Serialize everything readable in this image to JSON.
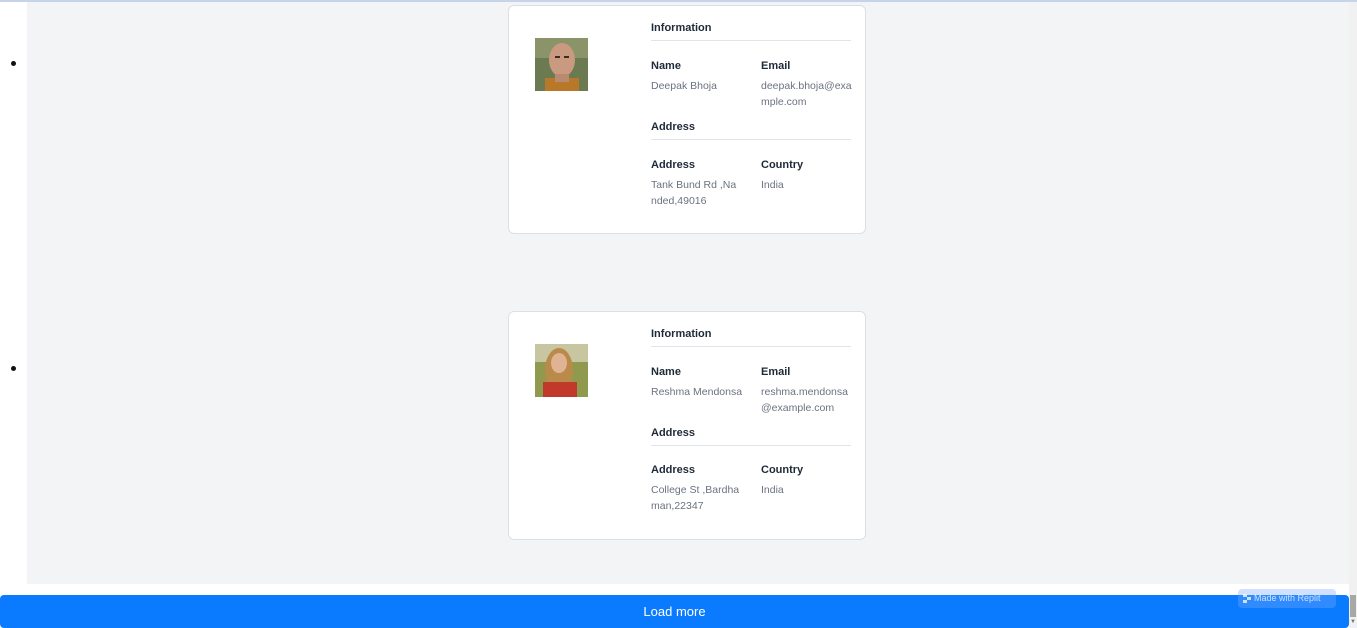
{
  "users": [
    {
      "section_information": "Information",
      "name_label": "Name",
      "name": "Deepak Bhoja",
      "email_label": "Email",
      "email": "deepak.bhoja@example.com",
      "section_address": "Address",
      "address_label": "Address",
      "address": "Tank Bund Rd ,Nanded,49016",
      "country_label": "Country",
      "country": "India"
    },
    {
      "section_information": "Information",
      "name_label": "Name",
      "name": "Reshma Mendonsa",
      "email_label": "Email",
      "email": "reshma.mendonsa@example.com",
      "section_address": "Address",
      "address_label": "Address",
      "address": "College St ,Bardhaman,22347",
      "country_label": "Country",
      "country": "India"
    }
  ],
  "load_more_label": "Load more",
  "replit_badge_label": "Made with Replit",
  "colors": {
    "accent": "#0a7bff",
    "list_background": "#f3f4f6",
    "card_border": "#dcdfe4"
  }
}
